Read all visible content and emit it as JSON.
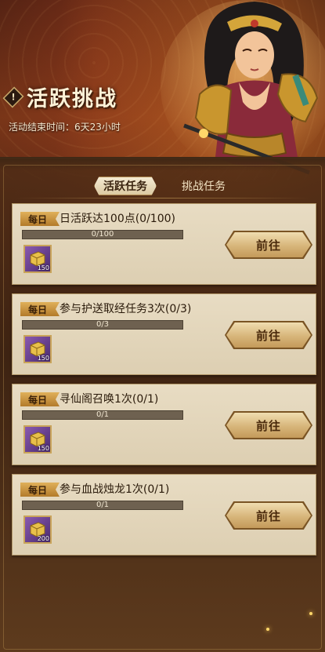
{
  "header": {
    "title_badge": "!",
    "title": "活跃挑战",
    "end_time_label": "活动结束时间：6天23小时"
  },
  "tabs": [
    {
      "label": "活跃任务",
      "active": true
    },
    {
      "label": "挑战任务",
      "active": false
    }
  ],
  "tasks": [
    {
      "tag": "每日",
      "title": "日活跃达100点(0/100)",
      "progress_text": "0/100",
      "progress": 0,
      "reward_count": "150",
      "button": "前往"
    },
    {
      "tag": "每日",
      "title": "参与护送取经任务3次(0/3)",
      "progress_text": "0/3",
      "progress": 0,
      "reward_count": "150",
      "button": "前往"
    },
    {
      "tag": "每日",
      "title": "寻仙阁召唤1次(0/1)",
      "progress_text": "0/1",
      "progress": 0,
      "reward_count": "150",
      "button": "前往"
    },
    {
      "tag": "每日",
      "title": "参与血战烛龙1次(0/1)",
      "progress_text": "0/1",
      "progress": 0,
      "reward_count": "200",
      "button": "前往"
    }
  ],
  "colors": {
    "accent": "#c9a45a",
    "card_bg": "#e6d9bf",
    "reward_purple": "#6a3f90"
  },
  "icons": {
    "reward": "gold-ingot-icon",
    "title_badge": "exclamation-badge-icon"
  }
}
